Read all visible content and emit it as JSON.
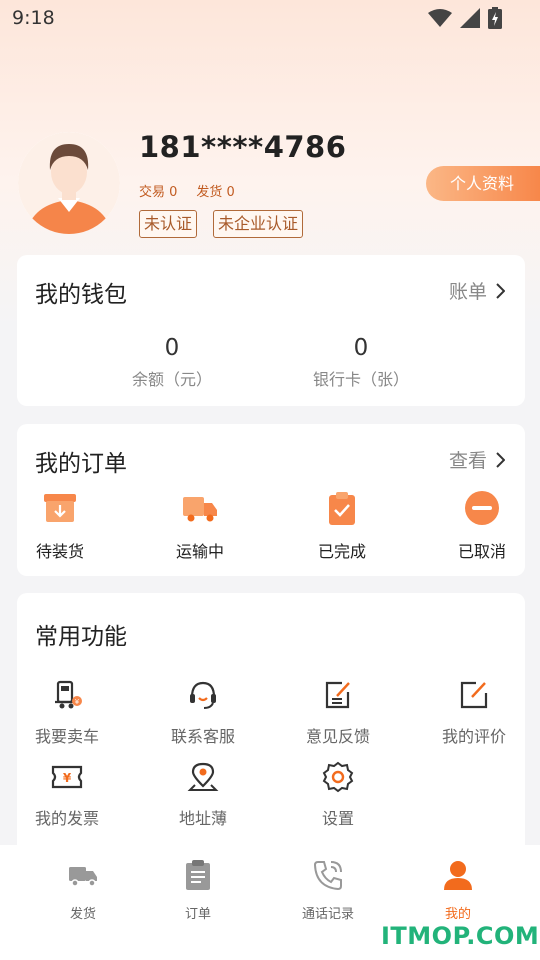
{
  "status_bar": {
    "time": "9:18"
  },
  "profile": {
    "phone": "181****4786",
    "trades_label": "交易 0",
    "shipments_label": "发货 0",
    "tags": [
      "未认证",
      "未企业认证"
    ],
    "profile_button": "个人资料"
  },
  "wallet": {
    "title": "我的钱包",
    "link": "账单",
    "items": [
      {
        "value": "0",
        "label": "余额（元）"
      },
      {
        "value": "0",
        "label": "银行卡（张）"
      }
    ]
  },
  "orders": {
    "title": "我的订单",
    "link": "查看",
    "items": [
      {
        "label": "待装货",
        "icon": "box-download-icon"
      },
      {
        "label": "运输中",
        "icon": "truck-icon"
      },
      {
        "label": "已完成",
        "icon": "clipboard-check-icon"
      },
      {
        "label": "已取消",
        "icon": "minus-circle-icon"
      }
    ]
  },
  "functions": {
    "title": "常用功能",
    "items": [
      {
        "label": "我要卖车",
        "icon": "truck-sell-icon"
      },
      {
        "label": "联系客服",
        "icon": "headset-icon"
      },
      {
        "label": "意见反馈",
        "icon": "feedback-icon"
      },
      {
        "label": "我的评价",
        "icon": "edit-icon"
      },
      {
        "label": "我的发票",
        "icon": "invoice-icon"
      },
      {
        "label": "地址薄",
        "icon": "location-icon"
      },
      {
        "label": "设置",
        "icon": "gear-icon"
      }
    ]
  },
  "tabbar": {
    "items": [
      {
        "label": "发货",
        "icon": "truck-icon"
      },
      {
        "label": "订单",
        "icon": "clipboard-icon"
      },
      {
        "label": "通话记录",
        "icon": "phone-icon"
      },
      {
        "label": "我的",
        "icon": "person-icon"
      }
    ],
    "active_index": 3
  },
  "watermark": "ITMOP.COM",
  "colors": {
    "accent": "#f26b1d",
    "orange_light": "#fbb786",
    "tag_border": "#b06a3a"
  }
}
